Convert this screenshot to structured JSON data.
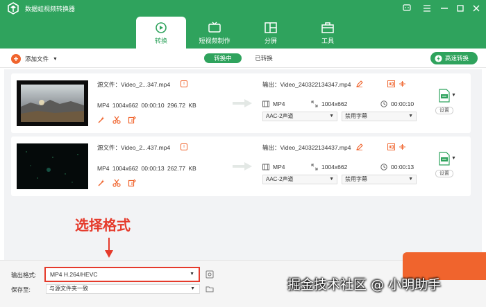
{
  "app": {
    "title": "数据蛙视频转换器"
  },
  "tabs": [
    {
      "label": "转换",
      "icon": "convert-icon",
      "active": true
    },
    {
      "label": "短视频制作",
      "icon": "tv-icon",
      "active": false
    },
    {
      "label": "分屏",
      "icon": "split-screen-icon",
      "active": false
    },
    {
      "label": "工具",
      "icon": "toolbox-icon",
      "active": false
    }
  ],
  "toolbar": {
    "add_label": "添加文件",
    "segments": [
      "转换中",
      "已转换"
    ],
    "fast_convert": "高速转换"
  },
  "files": [
    {
      "source": "源文件：Video_2...347.mp4",
      "source_meta": "MP4   1004x662   00:00:10   296.72 KB",
      "output": "输出：Video_240322134347.mp4",
      "out_format": "MP4",
      "out_res": "1004x662",
      "out_dur": "00:00:10",
      "audio": "AAC-2声道",
      "subtitle": "禁用字幕",
      "settings": "设置"
    },
    {
      "source": "源文件：Video_2...437.mp4",
      "source_meta": "MP4   1004x662   00:00:13   262.77 KB",
      "output": "输出：Video_240322134437.mp4",
      "out_format": "MP4",
      "out_res": "1004x662",
      "out_dur": "00:00:13",
      "audio": "AAC-2声道",
      "subtitle": "禁用字幕",
      "settings": "设置"
    }
  ],
  "annotation": "选择格式",
  "bottom": {
    "format_label": "输出格式:",
    "format_value": "MP4 H.264/HEVC",
    "save_label": "保存至:",
    "save_value": "与源文件夹一致"
  },
  "watermark": "掘金技术社区 @ 小明助手",
  "colors": {
    "brand": "#2fa35d",
    "accent": "#f0642d",
    "highlight": "#e53a2b"
  }
}
